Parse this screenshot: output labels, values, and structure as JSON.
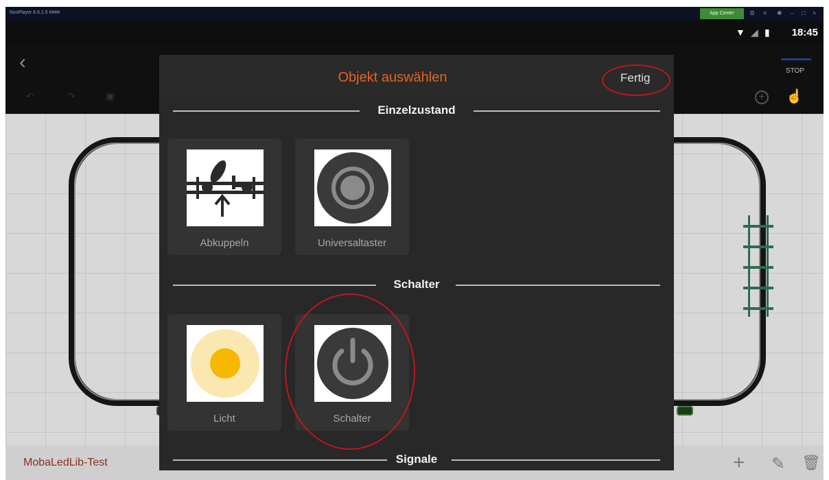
{
  "titlebar": {
    "title": "NoxPlayer 6.6.1.5 ####",
    "app_center": "App Center"
  },
  "statusbar": {
    "time": "18:45"
  },
  "toolbar": {
    "stop_label": "STOP"
  },
  "dialog": {
    "title": "Objekt auswählen",
    "done_label": "Fertig",
    "sections": [
      {
        "label": "Einzelzustand",
        "items": [
          {
            "label": "Abkuppeln",
            "icon": "uncouple-icon"
          },
          {
            "label": "Universaltaster",
            "icon": "universal-button-icon"
          }
        ]
      },
      {
        "label": "Schalter",
        "items": [
          {
            "label": "Licht",
            "icon": "light-icon"
          },
          {
            "label": "Schalter",
            "icon": "power-switch-icon"
          }
        ]
      },
      {
        "label": "Signale",
        "items": []
      }
    ]
  },
  "bottombar": {
    "layout_name": "MobaLedLib-Test"
  },
  "colors": {
    "accent": "#e8631f",
    "dialog_bg": "#282828",
    "tile_bg": "#333333",
    "light_center": "#f6b800",
    "light_halo": "#fbe7b0",
    "annotation": "#c4151c"
  }
}
